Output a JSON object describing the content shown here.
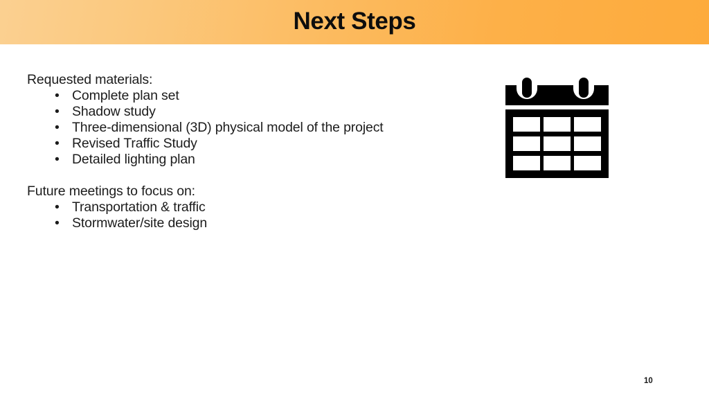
{
  "slide": {
    "title": "Next Steps",
    "page_number": "10",
    "header_gradient_from": "#fbd091",
    "header_gradient_to": "#fdab3c",
    "text_color": "#1c1c1c",
    "background": "#ffffff"
  },
  "content": {
    "sections": [
      {
        "heading": "Requested materials:",
        "items": [
          "Complete plan set",
          "Shadow study",
          "Three-dimensional (3D) physical model of the project",
          "Revised Traffic Study",
          "Detailed lighting plan"
        ]
      },
      {
        "heading": "Future meetings to focus on:",
        "items": [
          "Transportation & traffic",
          "Stormwater/site design"
        ]
      }
    ],
    "bullet_glyph": "•"
  },
  "graphic": {
    "icon": "calendar-icon",
    "color": "#000000"
  }
}
